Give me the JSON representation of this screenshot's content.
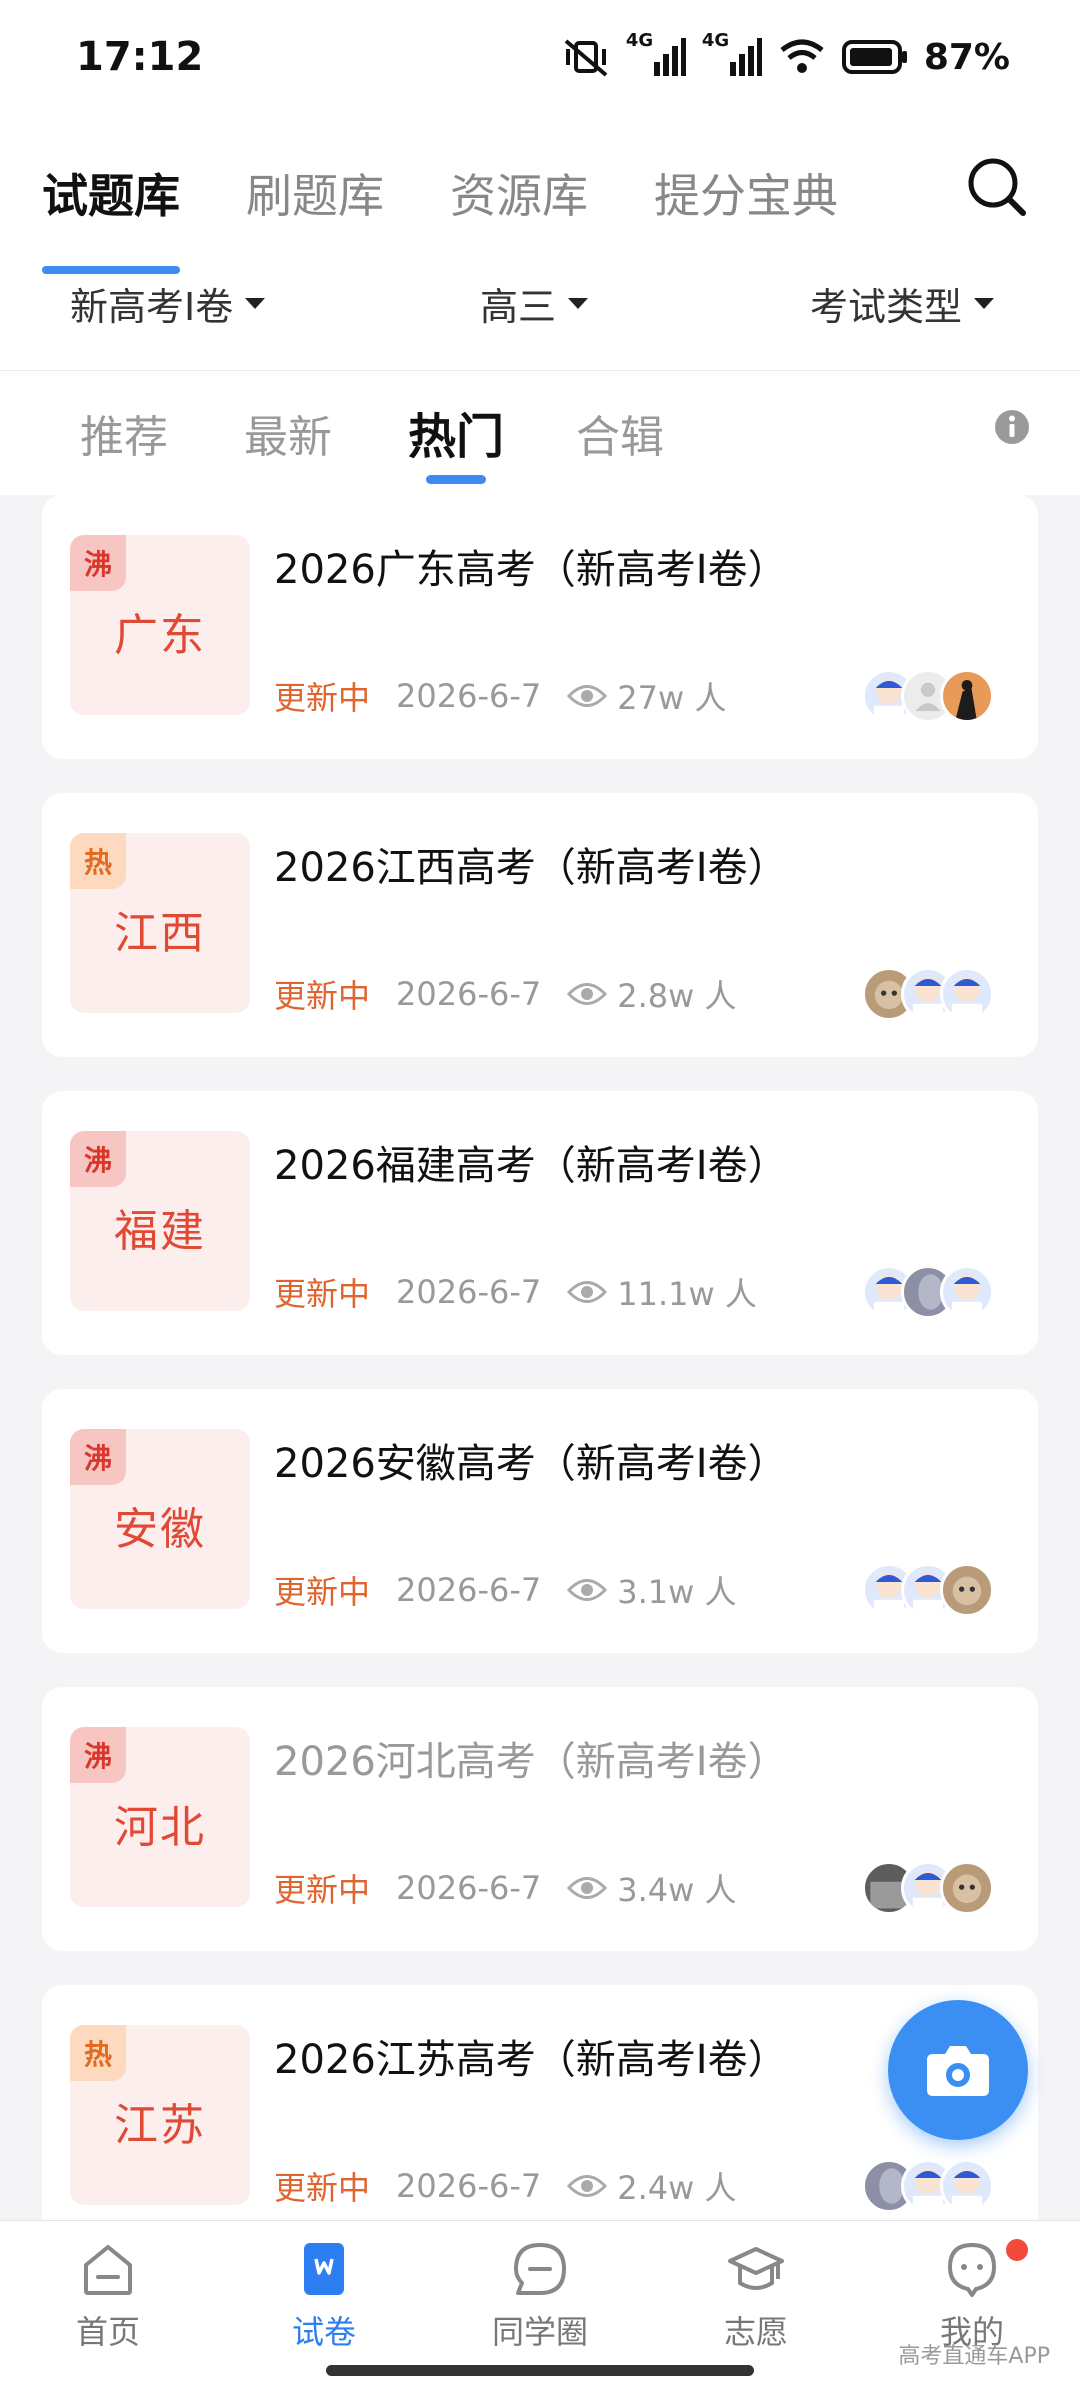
{
  "status_bar": {
    "time": "17:12",
    "signal_1": "4G",
    "signal_2": "4G",
    "battery": "87%"
  },
  "main_tabs": [
    {
      "label": "试题库",
      "active": true
    },
    {
      "label": "刷题库",
      "active": false
    },
    {
      "label": "资源库",
      "active": false
    },
    {
      "label": "提分宝典",
      "active": false
    }
  ],
  "filters": {
    "paper": "新高考Ⅰ卷",
    "grade": "高三",
    "exam_type": "考试类型"
  },
  "sub_tabs": [
    {
      "label": "推荐",
      "active": false
    },
    {
      "label": "最新",
      "active": false
    },
    {
      "label": "热门",
      "active": true
    },
    {
      "label": "合辑",
      "active": false
    }
  ],
  "cards": [
    {
      "tag": "沸",
      "tag_kind": "boil",
      "province": "广东",
      "title": "2026广东高考（新高考Ⅰ卷）",
      "status": "更新中",
      "date": "2026-6-7",
      "views": "27w 人",
      "dim": false
    },
    {
      "tag": "热",
      "tag_kind": "hot",
      "province": "江西",
      "title": "2026江西高考（新高考Ⅰ卷）",
      "status": "更新中",
      "date": "2026-6-7",
      "views": "2.8w 人",
      "dim": false
    },
    {
      "tag": "沸",
      "tag_kind": "boil",
      "province": "福建",
      "title": "2026福建高考（新高考Ⅰ卷）",
      "status": "更新中",
      "date": "2026-6-7",
      "views": "11.1w 人",
      "dim": false
    },
    {
      "tag": "沸",
      "tag_kind": "boil",
      "province": "安徽",
      "title": "2026安徽高考（新高考Ⅰ卷）",
      "status": "更新中",
      "date": "2026-6-7",
      "views": "3.1w 人",
      "dim": false
    },
    {
      "tag": "沸",
      "tag_kind": "boil",
      "province": "河北",
      "title": "2026河北高考（新高考Ⅰ卷）",
      "status": "更新中",
      "date": "2026-6-7",
      "views": "3.4w 人",
      "dim": true
    },
    {
      "tag": "热",
      "tag_kind": "hot",
      "province": "江苏",
      "title": "2026江苏高考（新高考Ⅰ卷）",
      "status": "更新中",
      "date": "2026-6-7",
      "views": "2.4w 人",
      "dim": false
    }
  ],
  "bottom_nav": [
    {
      "label": "首页",
      "icon": "home-icon",
      "active": false
    },
    {
      "label": "试卷",
      "icon": "paper-icon",
      "active": true
    },
    {
      "label": "同学圈",
      "icon": "chat-bubble-icon",
      "active": false
    },
    {
      "label": "志愿",
      "icon": "graduation-cap-icon",
      "active": false
    },
    {
      "label": "我的",
      "icon": "profile-icon",
      "active": false
    }
  ],
  "watermark": "高考直通车APP",
  "colors": {
    "accent": "#3f8bf0",
    "province_red": "#e04a35",
    "status_orange": "#e0642e"
  }
}
